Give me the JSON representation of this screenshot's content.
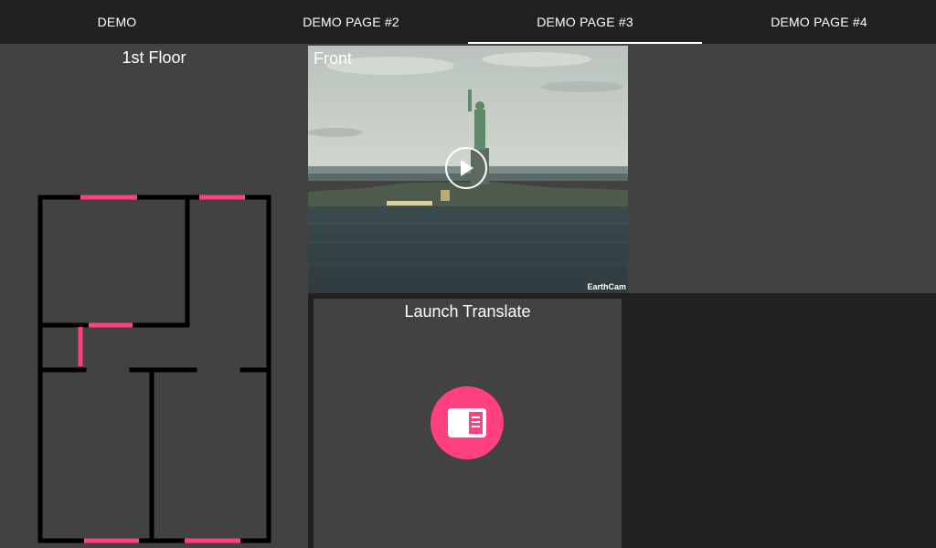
{
  "tabs": [
    {
      "label": "DEMO"
    },
    {
      "label": "DEMO PAGE #2"
    },
    {
      "label": "DEMO PAGE #3"
    },
    {
      "label": "DEMO PAGE #4"
    }
  ],
  "active_tab": "DEMO PAGE #3",
  "floor_card": {
    "title": "1st Floor"
  },
  "camera_card": {
    "label": "Front",
    "watermark": "EarthCam",
    "icon": "play-icon"
  },
  "translate_card": {
    "title": "Launch Translate",
    "icon": "translate-icon"
  },
  "colors": {
    "background": "#212121",
    "card": "#424242",
    "accent": "#ff4081",
    "wall": "#000000",
    "text": "#ffffff"
  }
}
